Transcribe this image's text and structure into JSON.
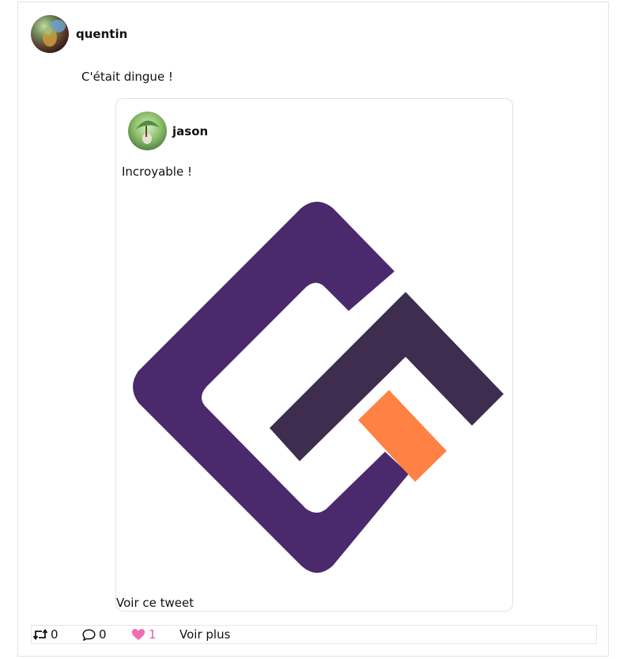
{
  "tweet": {
    "author": {
      "name": "quentin",
      "avatar_icon": "user-avatar-icon"
    },
    "text": "C'était dingue !",
    "quoted": {
      "author": {
        "name": "jason",
        "avatar_icon": "user-avatar-icon"
      },
      "text": "Incroyable !",
      "media_icon": "logo-image",
      "view_link": "Voir ce tweet"
    },
    "actions": {
      "retweet": {
        "icon": "retweet-icon",
        "count": "0"
      },
      "reply": {
        "icon": "reply-icon",
        "count": "0"
      },
      "like": {
        "icon": "heart-icon",
        "count": "1",
        "color": "#f06eb4"
      },
      "more_label": "Voir plus"
    }
  },
  "colors": {
    "logo_purple": "#4a2a6c",
    "logo_dark": "#3d2d4f",
    "logo_orange": "#ff8143",
    "border": "#e3e3e3"
  }
}
